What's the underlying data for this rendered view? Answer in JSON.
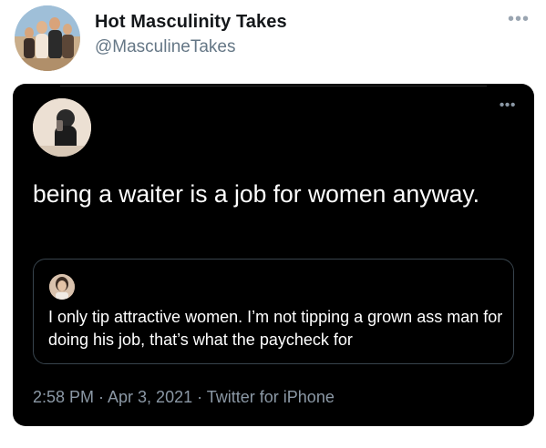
{
  "outer": {
    "name": "Hot Masculinity Takes",
    "handle": "@MasculineTakes",
    "more_icon": "more-horizontal-icon"
  },
  "card": {
    "more_icon": "more-horizontal-icon",
    "tweet_text": "being a waiter is a job for women anyway.",
    "quote": {
      "text": "I only tip attractive women. I’m not tipping a grown ass man for doing his job, that’s what the paycheck for"
    },
    "meta": "2:58 PM · Apr 3, 2021 · Twitter for iPhone"
  },
  "colors": {
    "name": "#14171a",
    "handle": "#657786",
    "card_bg": "#000000",
    "card_text": "#ffffff",
    "meta_text": "#8b98a5",
    "quote_border": "#38444d"
  }
}
